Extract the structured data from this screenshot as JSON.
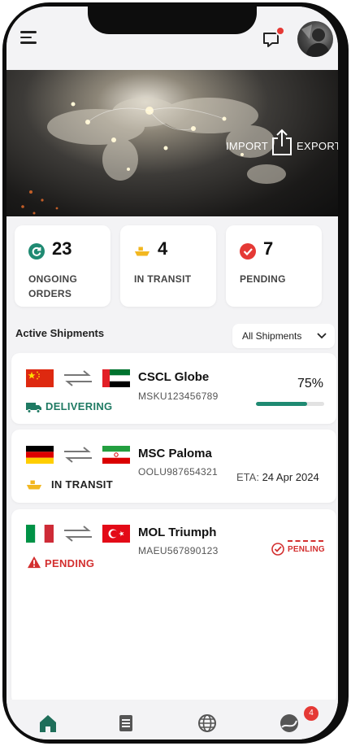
{
  "header": {
    "chat_icon": "chat-icon",
    "menu_icon": "menu-icon",
    "avatar": "avatar"
  },
  "hero": {
    "import_label": "IMPORT",
    "export_label": "EXPORT"
  },
  "stats": [
    {
      "value": "23",
      "label": "ONGOING ORDERS",
      "icon": "refresh-icon",
      "color": "#1f8a72"
    },
    {
      "value": "4",
      "label": "IN TRANSIT",
      "icon": "ship-icon",
      "color": "#f2b720"
    },
    {
      "value": "7",
      "label": "PENDING",
      "icon": "check-circle-icon",
      "color": "#e53935"
    }
  ],
  "shipments_section": {
    "title": "Active Shipments",
    "filter_value": "All Shipments"
  },
  "shipments": [
    {
      "vessel": "CSCL Globe",
      "code": "MSKU123456789",
      "status": "DELIVERING",
      "status_color": "#1f7a63",
      "progress_text": "75%",
      "progress": 0.75,
      "origin_flag": "china-flag",
      "dest_flag": "uae-flag"
    },
    {
      "vessel": "MSC Paloma",
      "code": "OOLU987654321",
      "status": "IN TRANSIT",
      "status_color": "#222222",
      "eta_label": "ETA:",
      "eta_value": "24 Apr 2024",
      "origin_flag": "germany-flag",
      "dest_flag": "iran-flag"
    },
    {
      "vessel": "MOL Triumph",
      "code": "MAEU567890123",
      "status": "PENDING",
      "status_color": "#d32f2f",
      "stamp": "PENLING",
      "origin_flag": "italy-flag",
      "dest_flag": "turkey-flag"
    }
  ],
  "bottom_nav": {
    "items": [
      "home-icon",
      "document-icon",
      "globe-icon",
      "profile-icon"
    ],
    "badge": "4",
    "active_color": "#1f6e5a"
  }
}
